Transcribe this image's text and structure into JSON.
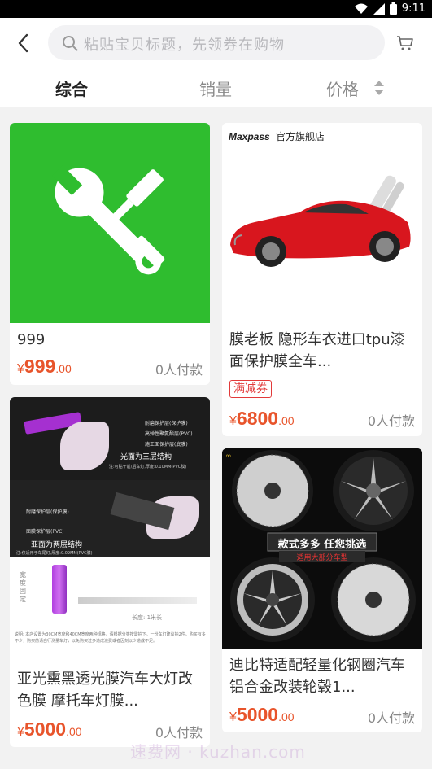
{
  "status_bar": {
    "time": "9:11"
  },
  "search": {
    "placeholder": "粘贴宝贝标题，先领券在购物"
  },
  "sort_tabs": [
    {
      "label": "综合",
      "active": true
    },
    {
      "label": "销量",
      "active": false
    },
    {
      "label": "价格",
      "active": false
    }
  ],
  "products": [
    {
      "title": "999",
      "currency": "¥",
      "price_int": "999",
      "price_dec": ".00",
      "sold": "0人付款"
    },
    {
      "shop_label": "Maxpass",
      "shop_tag": "官方旗舰店",
      "title": "膜老板 隐形车衣进口tpu漆面保护膜全车...",
      "badge": "满减券",
      "currency": "¥",
      "price_int": "6800",
      "price_dec": ".00",
      "sold": "0人付款"
    },
    {
      "title": "亚光熏黑透光膜汽车大灯改色膜 摩托车灯膜...",
      "currency": "¥",
      "price_int": "5000",
      "price_dec": ".00",
      "sold": "0人付款",
      "image_text": {
        "layer1": "耐磨保护层(保护膜)",
        "layer2": "高弹性聚氨酯层(PVC)",
        "layer3": "施工面保护层(底膜)",
        "heading_top": "光面为三层结构",
        "sub_top": "注:可贴于前/后车灯,厚度:0.10MM(PVC膜)",
        "layer4": "耐磨保护层(保护膜)",
        "layer5": "面膜保护层(PVC)",
        "heading_bottom": "亚面为两层结构",
        "sub_bottom": "注:仅适用于车尾灯,厚度:0.09MM(PVC膜)",
        "width_label": "宽度固定",
        "length_label": "长度: 1米长",
        "note": "说明: 本店设置为30CM宽度和40CM宽度两种规格，请根据分类按需拍下。一份车灯建议拍2件。购买有多不少，购买前请自行测量车灯，以免购买过多造成浪费或者因刻以少造成不足。"
      }
    },
    {
      "title": "迪比特适配轻量化钢圈汽车铝合金改装轮毂1...",
      "currency": "¥",
      "price_int": "5000",
      "price_dec": ".00",
      "sold": "0人付款",
      "image_banner": "款式多多 任您挑选",
      "image_sub": "适用大部分车型"
    }
  ],
  "watermark": "速费网 · kuzhan.com",
  "colors": {
    "accent_price": "#e8542b",
    "badge_red": "#e23a3a",
    "icon_green": "#2fbd2f"
  }
}
